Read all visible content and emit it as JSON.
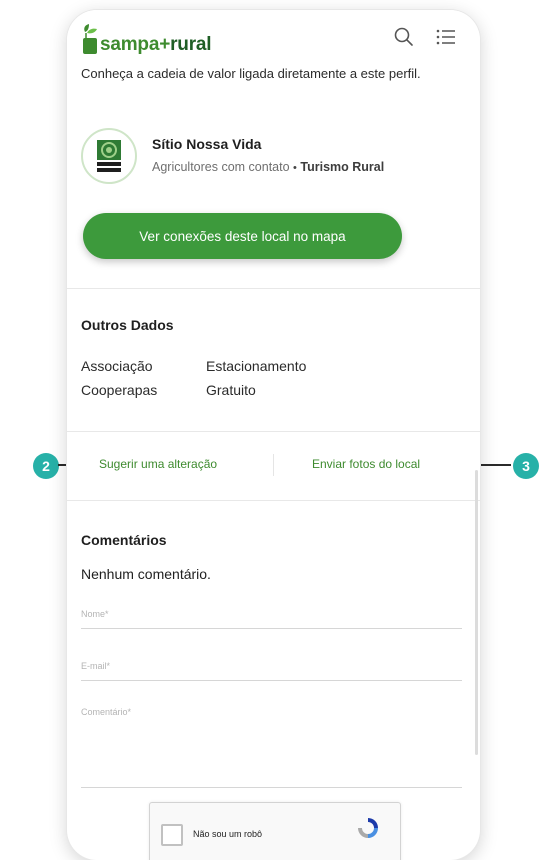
{
  "header": {
    "logo_part1": "sampa",
    "logo_plus": "+",
    "logo_part2": "rural",
    "search_icon": "search-icon",
    "menu_icon": "list-menu-icon"
  },
  "intro_text": "Conheça a cadeia de valor ligada diretamente a este perfil.",
  "profile": {
    "name": "Sítio Nossa Vida",
    "category": "Agricultores com contato",
    "separator": "•",
    "tag": "Turismo Rural"
  },
  "map_button_label": "Ver conexões deste local no mapa",
  "other_data": {
    "title": "Outros Dados",
    "col1": [
      "Associação",
      "Cooperapas"
    ],
    "col2": [
      "Estacionamento",
      "Gratuito"
    ]
  },
  "actions": {
    "suggest": "Sugerir uma alteração",
    "send_photos": "Enviar fotos do local"
  },
  "comments": {
    "title": "Comentários",
    "empty": "Nenhum comentário.",
    "name_placeholder": "Nome*",
    "email_placeholder": "E-mail*",
    "comment_placeholder": "Comentário*"
  },
  "captcha": {
    "label": "Não sou um robô",
    "icon": "recaptcha-icon"
  },
  "callouts": {
    "left": "2",
    "right": "3"
  },
  "colors": {
    "brand_green": "#3d9a3c",
    "dark_green": "#1f5e25",
    "callout_teal": "#27b1a8"
  }
}
